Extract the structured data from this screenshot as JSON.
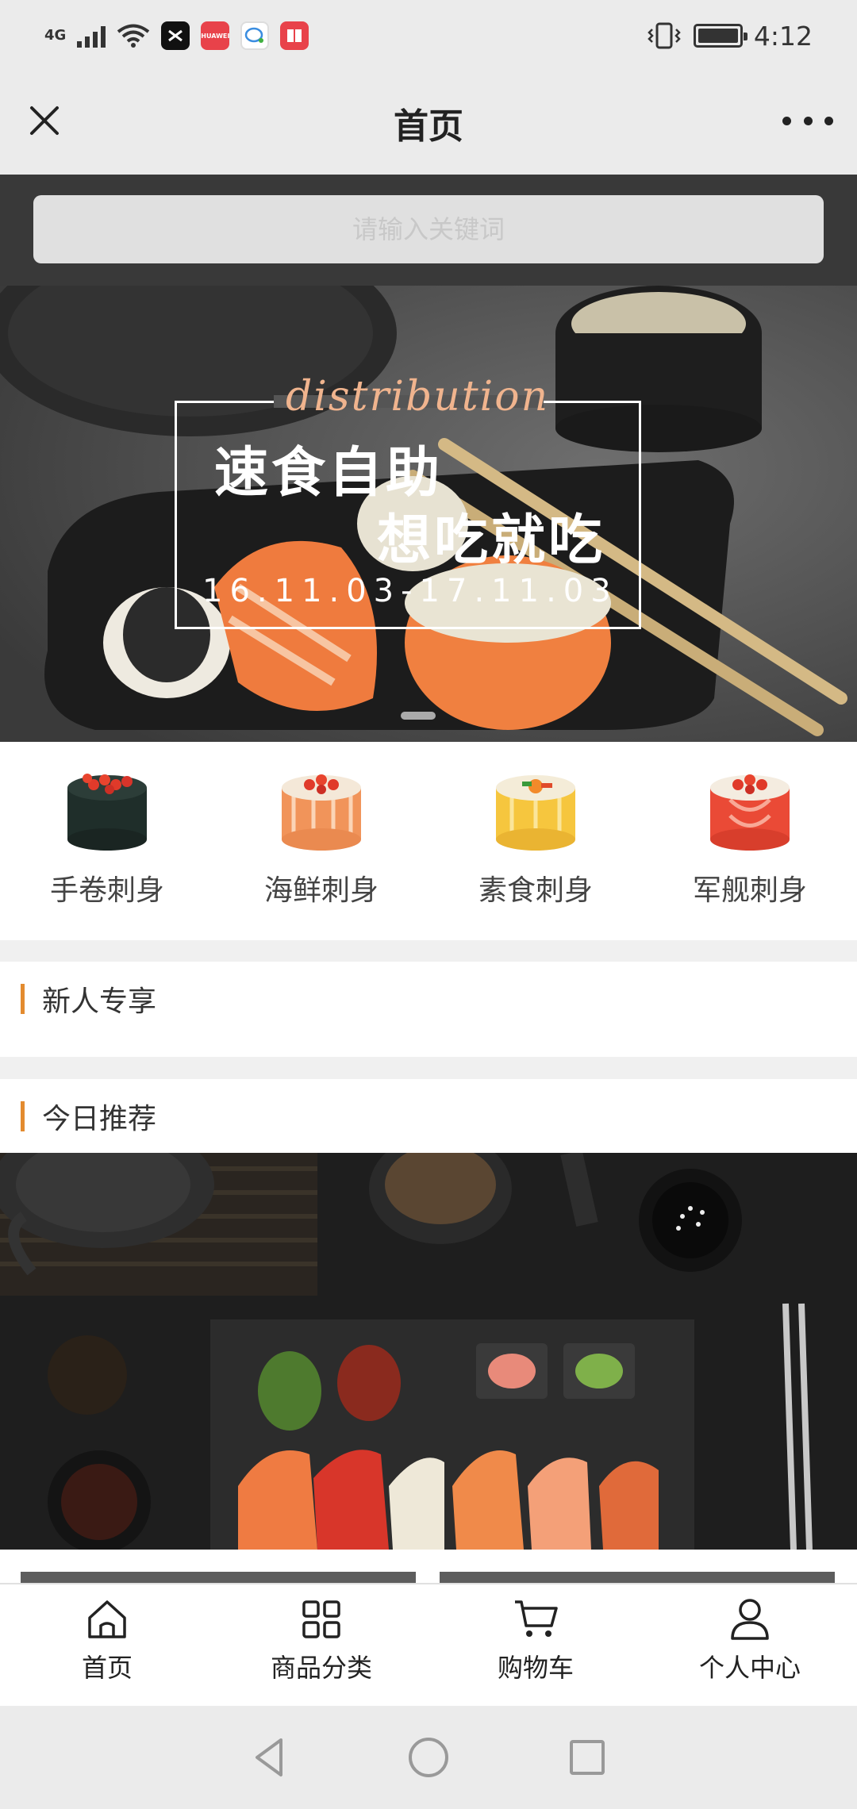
{
  "status_bar": {
    "network": "4G",
    "time": "4:12",
    "apps": [
      "capcut-icon",
      "huawei-icon",
      "chat-icon",
      "book-icon"
    ],
    "huawei_label": "HUAWEI"
  },
  "header": {
    "title": "首页"
  },
  "search": {
    "placeholder": "请输入关键词"
  },
  "banner": {
    "script_text": "distribution",
    "line1": "速食自助",
    "line2": "想吃就吃",
    "date": "16.11.03-17.11.03"
  },
  "categories": [
    {
      "label": "手卷刺身",
      "icon": "sushi-roll-dark-icon"
    },
    {
      "label": "海鲜刺身",
      "icon": "sushi-roll-salmon-icon"
    },
    {
      "label": "素食刺身",
      "icon": "sushi-roll-egg-icon"
    },
    {
      "label": "军舰刺身",
      "icon": "sushi-roll-red-icon"
    }
  ],
  "sections": {
    "new_user": "新人专享",
    "today": "今日推荐"
  },
  "bottom_nav": [
    {
      "label": "首页",
      "icon": "home-icon"
    },
    {
      "label": "商品分类",
      "icon": "grid-icon"
    },
    {
      "label": "购物车",
      "icon": "cart-icon"
    },
    {
      "label": "个人中心",
      "icon": "user-icon"
    }
  ],
  "colors": {
    "accent": "#e38b2f",
    "search_bg": "#393939",
    "bar_bg": "#ebebeb"
  }
}
